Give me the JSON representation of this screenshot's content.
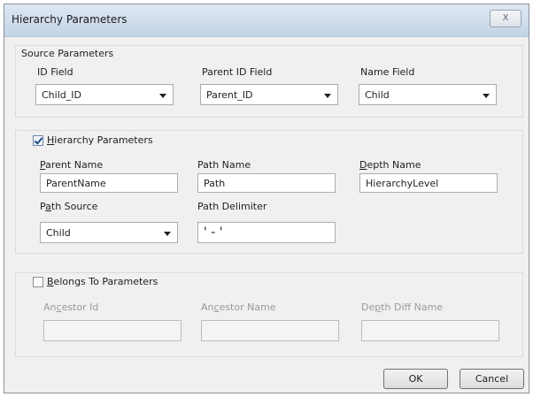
{
  "dialog": {
    "title": "Hierarchy Parameters",
    "close_label": "X"
  },
  "source": {
    "section_title": "Source Parameters",
    "id_field": {
      "label": "ID Field",
      "value": "Child_ID"
    },
    "parent_id_field": {
      "label": "Parent ID Field",
      "value": "Parent_ID"
    },
    "name_field": {
      "label": "Name Field",
      "value": "Child"
    }
  },
  "hierarchy": {
    "checked": true,
    "section_title_accel": "H",
    "section_title_rest": "ierarchy Parameters",
    "parent_name": {
      "label_accel": "P",
      "label_rest": "arent Name",
      "value": "ParentName"
    },
    "path_name": {
      "label": "Path Name",
      "value": "Path"
    },
    "depth_name": {
      "label_accel": "D",
      "label_rest": "epth Name",
      "value": "HierarchyLevel"
    },
    "path_source": {
      "label_pre": "P",
      "label_accel": "a",
      "label_rest": "th Source",
      "value": "Child"
    },
    "path_delimiter": {
      "label": "Path Delimiter",
      "value": "' - '"
    }
  },
  "belongs": {
    "checked": false,
    "section_title_accel": "B",
    "section_title_rest": "elongs To Parameters",
    "ancestor_id": {
      "label_pre": "An",
      "label_accel": "c",
      "label_rest": "estor Id",
      "value": ""
    },
    "ancestor_name": {
      "label_pre": "An",
      "label_accel": "c",
      "label_rest": "estor Name",
      "value": ""
    },
    "depth_diff_name": {
      "label_pre": "De",
      "label_accel": "p",
      "label_rest": "th Diff Name",
      "value": ""
    }
  },
  "buttons": {
    "ok": "OK",
    "cancel": "Cancel"
  },
  "colors": {
    "title_gradient_top": "#dfe8f3",
    "dialog_bg": "#f0f0f0",
    "check_mark": "#1f4f86"
  }
}
